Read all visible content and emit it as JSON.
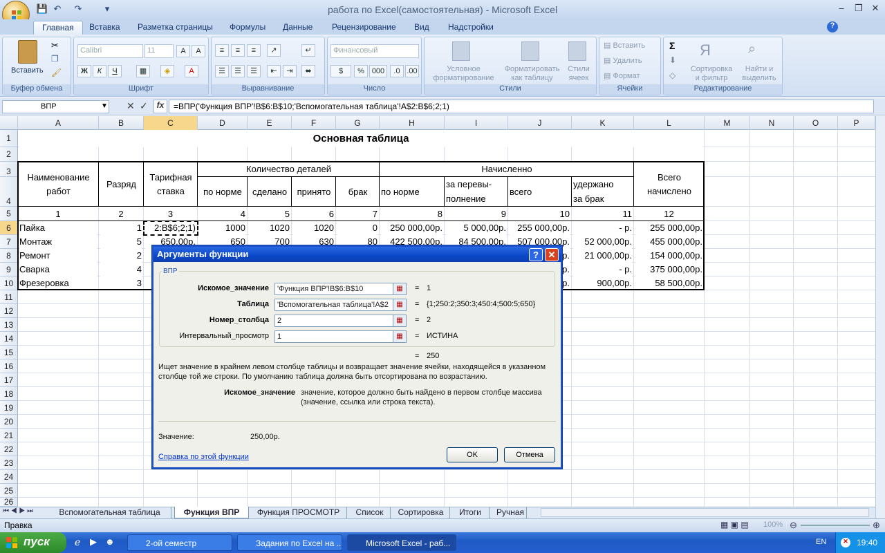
{
  "window": {
    "title": "работа по Excel(самостоятельная) - Microsoft Excel"
  },
  "tabs": [
    "Главная",
    "Вставка",
    "Разметка страницы",
    "Формулы",
    "Данные",
    "Рецензирование",
    "Вид",
    "Надстройки"
  ],
  "ribbon": {
    "clipboard": {
      "label": "Буфер обмена",
      "paste": "Вставить"
    },
    "font": {
      "label": "Шрифт",
      "family": "Calibri",
      "size": "11"
    },
    "alignment": {
      "label": "Выравнивание"
    },
    "number": {
      "label": "Число",
      "format": "Финансовый"
    },
    "styles": {
      "label": "Стили",
      "cond1": "Условное",
      "cond2": "форматирование",
      "fmt1": "Форматировать",
      "fmt2": "как таблицу",
      "cell1": "Стили",
      "cell2": "ячеек"
    },
    "cells": {
      "label": "Ячейки",
      "insert": "Вставить",
      "delete": "Удалить",
      "format": "Формат"
    },
    "editing": {
      "label": "Редактирование",
      "sort1": "Сортировка",
      "sort2": "и фильтр",
      "find1": "Найти и",
      "find2": "выделить"
    }
  },
  "formula_bar": {
    "name_box": "ВПР",
    "formula": "=ВПР('Функция ВПР'!B$6:B$10;'Вспомогательная таблица'!A$2:B$6;2;1)"
  },
  "columns": [
    "A",
    "B",
    "C",
    "D",
    "E",
    "F",
    "G",
    "H",
    "I",
    "J",
    "K",
    "L",
    "M",
    "N",
    "O",
    "P"
  ],
  "rows": [
    "1",
    "2",
    "3",
    "4",
    "5",
    "6",
    "7",
    "8",
    "9",
    "10",
    "11",
    "12",
    "13",
    "14",
    "15",
    "16",
    "17",
    "18",
    "19",
    "20",
    "21",
    "22",
    "23",
    "24",
    "25",
    "26"
  ],
  "sheet": {
    "title": "Основная таблица",
    "h_name": "Наименование работ",
    "h_rank": "Разряд",
    "h_rate": "Тарифная ставка",
    "h_qty": "Количество деталей",
    "h_qty_norm": "по норме",
    "h_qty_done": "сделано",
    "h_qty_acc": "принято",
    "h_qty_def": "брак",
    "h_acc": "Начисленно",
    "h_acc_norm": "по норме",
    "h_acc_over1": "за перевы-",
    "h_acc_over2": "полнение",
    "h_acc_all": "всего",
    "h_acc_ded1": "удержано",
    "h_acc_ded2": "за брак",
    "h_total": "Всего начислено",
    "nums": [
      "1",
      "2",
      "3",
      "4",
      "5",
      "6",
      "7",
      "8",
      "9",
      "10",
      "11",
      "12"
    ],
    "r6": [
      "Пайка",
      "1",
      "2:B$6;2;1)",
      "1000",
      "1020",
      "1020",
      "0",
      "250 000,00р.",
      "5 000,00р.",
      "255 000,00р.",
      "-    р.",
      "255 000,00р."
    ],
    "r7": [
      "Монтаж",
      "5",
      "650,00р.",
      "650",
      "700",
      "630",
      "80",
      "422 500,00р.",
      "84 500,00р.",
      "507 000,00р.",
      "52 000,00р.",
      "455 000,00р."
    ],
    "r8": [
      "Ремонт",
      "2",
      "",
      "",
      "",
      "",
      "",
      "",
      "",
      "р.",
      "21 000,00р.",
      "154 000,00р."
    ],
    "r9": [
      "Сварка",
      "4",
      "",
      "",
      "",
      "",
      "",
      "",
      "",
      "р.",
      "-    р.",
      "375 000,00р."
    ],
    "r10": [
      "Фрезеровка",
      "3",
      "",
      "",
      "",
      "",
      "",
      "",
      "",
      "р.",
      "900,00р.",
      "58 500,00р."
    ]
  },
  "sheet_tabs": [
    "Вспомогательная таблица",
    "Функция ВПР",
    "Функция ПРОСМОТР",
    "Список",
    "Сортировка",
    "Итоги",
    "Ручная"
  ],
  "status": {
    "mode": "Правка",
    "zoom": "100%"
  },
  "dialog": {
    "title": "Аргументы функции",
    "group": "ВПР",
    "args": [
      {
        "label": "Искомое_значение",
        "value": "'Функция ВПР'!B$6:B$10",
        "result": "1",
        "bold": true
      },
      {
        "label": "Таблица",
        "value": "'Вспомогательная таблица'!A$2",
        "result": "{1;250:2;350:3;450:4;500:5;650}",
        "bold": true
      },
      {
        "label": "Номер_столбца",
        "value": "2",
        "result": "2",
        "bold": true
      },
      {
        "label": "Интервальный_просмотр",
        "value": "1",
        "result": "ИСТИНА",
        "bold": false
      }
    ],
    "eq": "=",
    "total": "250",
    "desc": "Ищет значение в крайнем левом столбце таблицы и возвращает значение ячейки, находящейся в указанном столбце той же строки. По умолчанию таблица должна быть отсортирована по возрастанию.",
    "arg_name": "Искомое_значение",
    "arg_desc": "значение, которое должно быть найдено в первом столбце массива (значение, ссылка или строка текста).",
    "value_label": "Значение:",
    "value": "250,00р.",
    "help": "Справка по этой функции",
    "ok": "OK",
    "cancel": "Отмена"
  },
  "taskbar": {
    "start": "пуск",
    "items": [
      "2-ой семестр",
      "Задания по Excel на ...",
      "Microsoft Excel - раб..."
    ],
    "lang": "EN",
    "time": "19:40"
  }
}
